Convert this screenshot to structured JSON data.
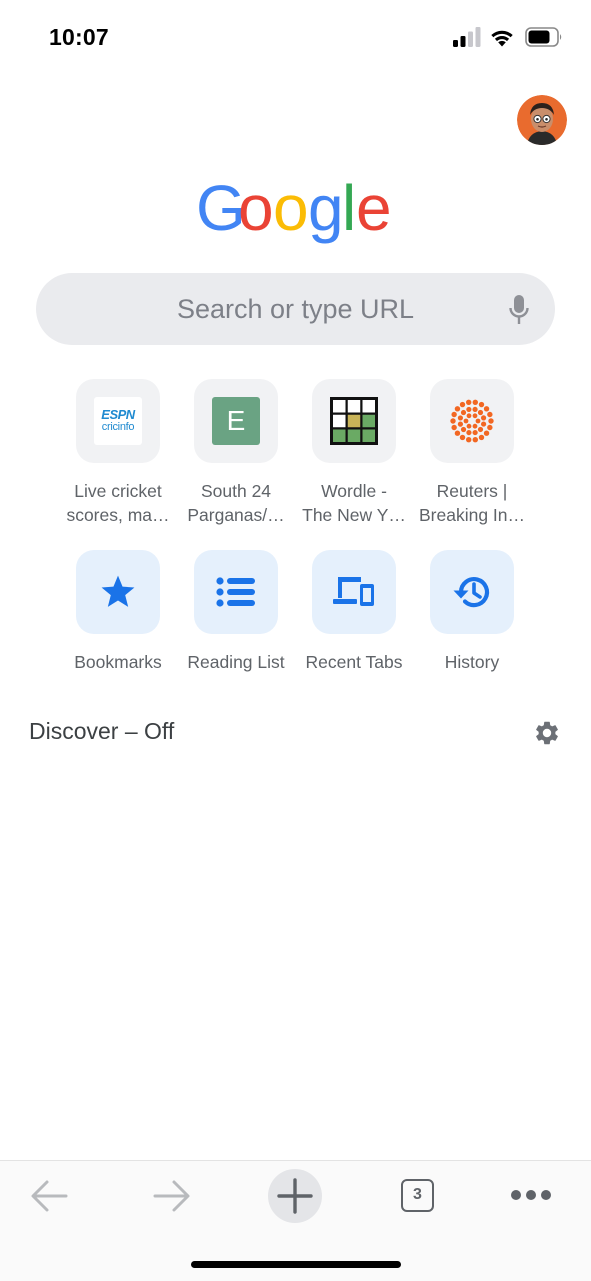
{
  "status_bar": {
    "time": "10:07",
    "icons": [
      "cellular-signal-icon",
      "wifi-icon",
      "battery-icon"
    ]
  },
  "header": {
    "avatar": "avatar-icon"
  },
  "logo": {
    "letters": [
      "G",
      "o",
      "o",
      "g",
      "l",
      "e"
    ],
    "colors": [
      "#4285f4",
      "#ea4335",
      "#fbbc05",
      "#4285f4",
      "#34a853",
      "#ea4335"
    ]
  },
  "omnibox": {
    "placeholder": "Search or type URL",
    "mic_icon": "microphone-icon"
  },
  "most_visited": [
    {
      "label": "Live cricket\nscores, ma…",
      "icon_line1": "ESPN",
      "icon_line2": "cricinfo"
    },
    {
      "label": "South 24\nParganas/…",
      "icon_letter": "E",
      "icon_color": "#6aa383"
    },
    {
      "label": "Wordle -\nThe New Y…",
      "icon": "wordle-grid-icon"
    },
    {
      "label": "Reuters |\nBreaking In…",
      "icon": "reuters-logo-icon",
      "icon_color": "#f26722"
    }
  ],
  "shortcuts": [
    {
      "label": "Bookmarks",
      "icon": "star-icon"
    },
    {
      "label": "Reading List",
      "icon": "list-icon"
    },
    {
      "label": "Recent Tabs",
      "icon": "devices-icon"
    },
    {
      "label": "History",
      "icon": "history-icon"
    }
  ],
  "discover": {
    "label": "Discover – Off",
    "settings_icon": "gear-icon"
  },
  "toolbar": {
    "back_icon": "back-arrow-icon",
    "forward_icon": "forward-arrow-icon",
    "new_tab_icon": "plus-icon",
    "tab_count": "3",
    "menu_icon": "more-dots-icon"
  },
  "colors": {
    "accent": "#1a73e8",
    "icon_grey": "#5f6368",
    "tile_blue_bg": "#e5f0fc"
  }
}
